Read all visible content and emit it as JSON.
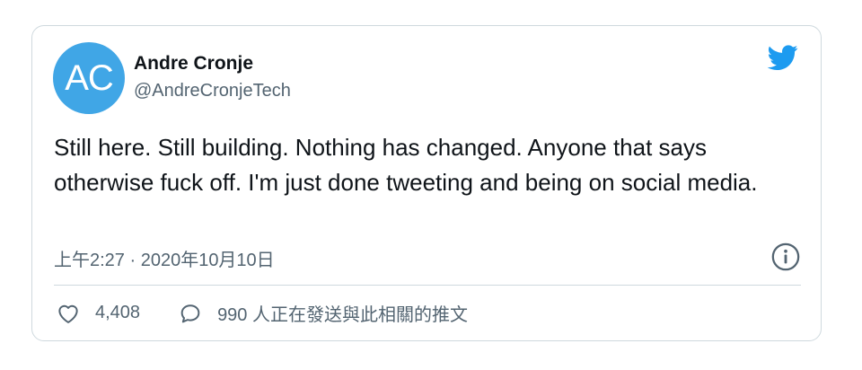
{
  "author": {
    "avatar_initials": "AC",
    "avatar_color": "#40a6e6",
    "name": "Andre Cronje",
    "handle": "@AndreCronjeTech"
  },
  "tweet": {
    "text": "Still here. Still building. Nothing has changed. Anyone that says otherwise fuck off. I'm just done tweeting and being on social media.",
    "timestamp": "上午2:27 · 2020年10月10日"
  },
  "actions": {
    "likes": "4,408",
    "replies_label": "990 人正在發送與此相關的推文"
  },
  "icons": {
    "brand": "twitter-bird-icon",
    "info": "info-icon",
    "like": "heart-icon",
    "reply": "comment-icon"
  },
  "colors": {
    "brand_blue": "#1d9bf0",
    "text_primary": "#0f1419",
    "text_secondary": "#536471",
    "border": "#cfd9de"
  }
}
